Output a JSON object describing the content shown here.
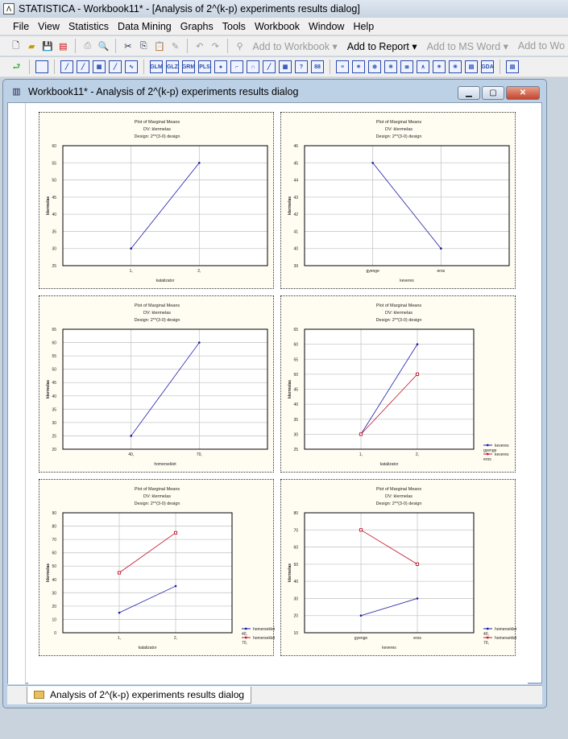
{
  "window_title": "STATISTICA - Workbook11* - [Analysis of 2^(k-p) experiments results dialog]",
  "menu": [
    "File",
    "View",
    "Statistics",
    "Data Mining",
    "Graphs",
    "Tools",
    "Workbook",
    "Window",
    "Help"
  ],
  "toolbar": {
    "add_to_workbook": "Add to Workbook ▾",
    "add_to_report": "Add to Report ▾",
    "add_to_ms_word": "Add to MS Word ▾",
    "add_to_wo": "Add to Wo"
  },
  "mdi": {
    "title": "Workbook11* - Analysis of 2^(k-p) experiments results dialog",
    "tab_label": "Analysis of 2^(k-p) experiments results dialog"
  },
  "colors": {
    "blue": "#1a1aa6",
    "red": "#c0102a",
    "panel_bg": "#fffdf2"
  },
  "chart_data": [
    {
      "type": "line",
      "title": "Plot of Marginal Means",
      "subtitle1": "DV: klermelas",
      "subtitle2": "Design: 2**(3-0) design",
      "xlabel": "katalizator",
      "ylabel": "klermelas",
      "categories": [
        "1,",
        "2,"
      ],
      "ylim": [
        25,
        60
      ],
      "yticks": [
        25,
        30,
        35,
        40,
        45,
        50,
        55,
        60
      ],
      "grid": true,
      "series": [
        {
          "values": [
            30,
            55
          ],
          "color": "#1a1aa6",
          "marker": "diamond"
        }
      ]
    },
    {
      "type": "line",
      "title": "Plot of Marginal Means",
      "subtitle1": "DV: klermelas",
      "subtitle2": "Design: 2**(3-0) design",
      "xlabel": "keveres",
      "ylabel": "klermelas",
      "categories": [
        "gyenge",
        "eros"
      ],
      "ylim": [
        39,
        46
      ],
      "yticks": [
        39,
        40,
        41,
        42,
        43,
        44,
        45,
        46
      ],
      "grid": true,
      "series": [
        {
          "values": [
            45,
            40
          ],
          "color": "#1a1aa6",
          "marker": "diamond"
        }
      ]
    },
    {
      "type": "line",
      "title": "Plot of Marginal Means",
      "subtitle1": "DV: klermelas",
      "subtitle2": "Design: 2**(3-0) design",
      "xlabel": "homerseklet",
      "ylabel": "klermelas",
      "categories": [
        "40,",
        "70,"
      ],
      "ylim": [
        20,
        65
      ],
      "yticks": [
        20,
        25,
        30,
        35,
        40,
        45,
        50,
        55,
        60,
        65
      ],
      "grid": true,
      "series": [
        {
          "values": [
            25,
            60
          ],
          "color": "#1a1aa6",
          "marker": "diamond"
        }
      ]
    },
    {
      "type": "line",
      "title": "Plot of Marginal Means",
      "subtitle1": "DV: klermelas",
      "subtitle2": "Design: 2**(3-0) design",
      "xlabel": "katalizator",
      "ylabel": "klermelas",
      "categories": [
        "1,",
        "2,"
      ],
      "ylim": [
        25,
        65
      ],
      "yticks": [
        25,
        30,
        35,
        40,
        45,
        50,
        55,
        60,
        65
      ],
      "grid": true,
      "legend": "right",
      "series": [
        {
          "name": "keveres",
          "name2": "gyenge",
          "values": [
            30,
            60
          ],
          "color": "#1a1aa6",
          "marker": "diamond"
        },
        {
          "name": "keveres",
          "name2": "eros",
          "values": [
            30,
            50
          ],
          "color": "#c0102a",
          "marker": "square"
        }
      ]
    },
    {
      "type": "line",
      "title": "Plot of Marginal Means",
      "subtitle1": "DV: klermelas",
      "subtitle2": "Design: 2**(3-0) design",
      "xlabel": "katalizator",
      "ylabel": "klermelas",
      "categories": [
        "1,",
        "2,"
      ],
      "ylim": [
        0,
        90
      ],
      "yticks": [
        0,
        10,
        20,
        30,
        40,
        50,
        60,
        70,
        80,
        90
      ],
      "grid": true,
      "legend": "right",
      "series": [
        {
          "name": "homerseklet",
          "name2": "40,",
          "values": [
            15,
            35
          ],
          "color": "#1a1aa6",
          "marker": "diamond"
        },
        {
          "name": "homerseklet",
          "name2": "70,",
          "values": [
            45,
            75
          ],
          "color": "#c0102a",
          "marker": "square"
        }
      ]
    },
    {
      "type": "line",
      "title": "Plot of Marginal Means",
      "subtitle1": "DV: klermelas",
      "subtitle2": "Design: 2**(3-0) design",
      "xlabel": "keveres",
      "ylabel": "klermelas",
      "categories": [
        "gyenge",
        "eros"
      ],
      "ylim": [
        10,
        80
      ],
      "yticks": [
        10,
        20,
        30,
        40,
        50,
        60,
        70,
        80
      ],
      "grid": true,
      "legend": "right",
      "series": [
        {
          "name": "homerseklet",
          "name2": "40,",
          "values": [
            20,
            30
          ],
          "color": "#1a1aa6",
          "marker": "diamond"
        },
        {
          "name": "homerseklet",
          "name2": "70,",
          "values": [
            70,
            50
          ],
          "color": "#c0102a",
          "marker": "square"
        }
      ]
    }
  ]
}
